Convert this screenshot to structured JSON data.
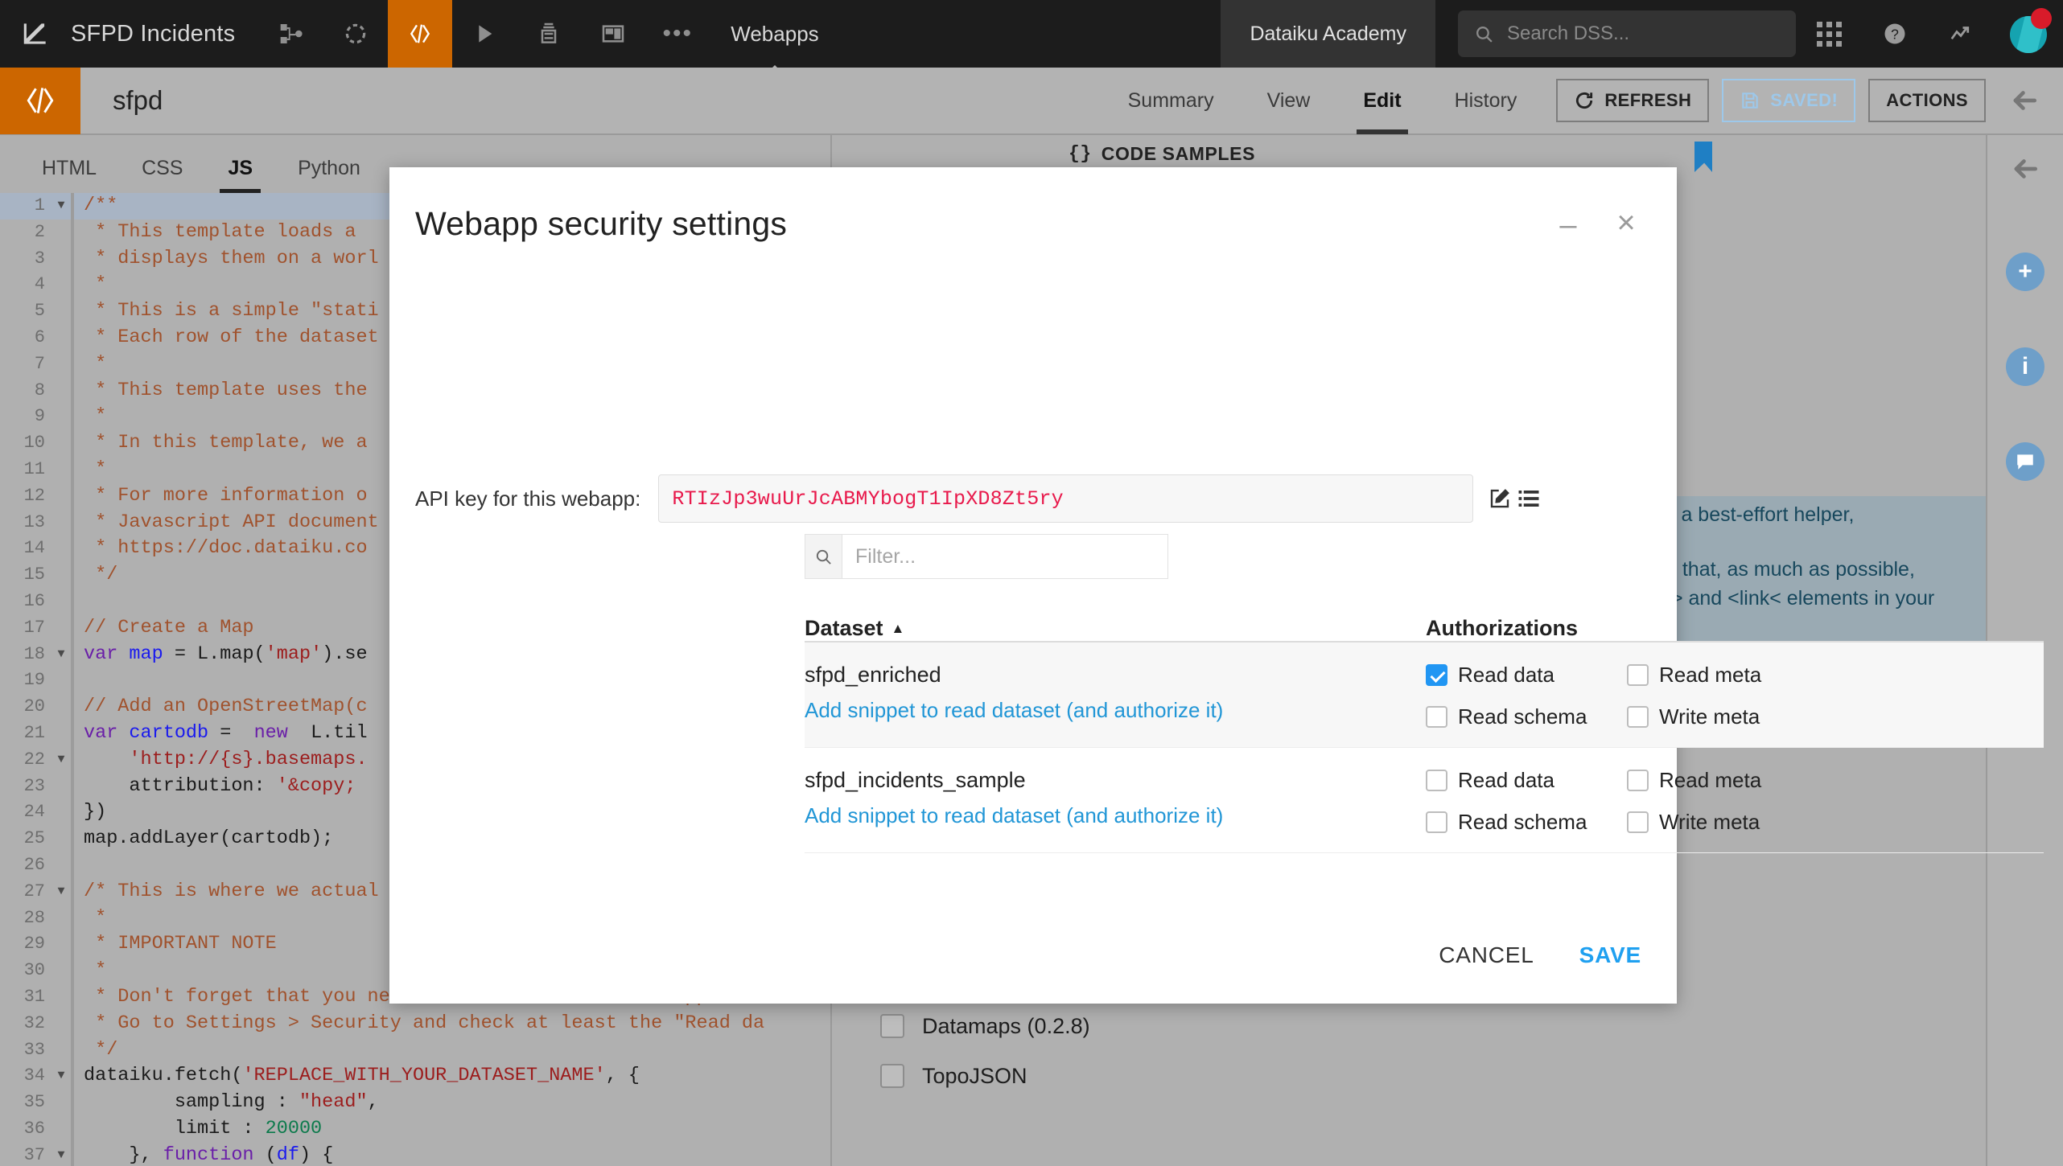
{
  "topnav": {
    "logo_icon": "dataiku-logo-icon",
    "project_name": "SFPD Incidents",
    "icons": [
      {
        "name": "flow-icon"
      },
      {
        "name": "lab-icon"
      },
      {
        "name": "code-icon"
      },
      {
        "name": "automation-icon"
      },
      {
        "name": "jobs-icon"
      },
      {
        "name": "dashboards-icon"
      },
      {
        "name": "more-icon"
      }
    ],
    "section_label": "Webapps",
    "academy_label": "Dataiku Academy",
    "search_placeholder": "Search DSS...",
    "right_icons": [
      {
        "name": "apps-grid-icon"
      },
      {
        "name": "help-icon"
      },
      {
        "name": "activity-icon"
      },
      {
        "name": "avatar"
      }
    ]
  },
  "subbar": {
    "webapp_icon": "code-webapp-icon",
    "title": "sfpd",
    "tabs": [
      {
        "label": "Summary",
        "active": false
      },
      {
        "label": "View",
        "active": false
      },
      {
        "label": "Edit",
        "active": true
      },
      {
        "label": "History",
        "active": false
      }
    ],
    "refresh_label": "REFRESH",
    "saved_label": "SAVED!",
    "actions_label": "ACTIONS",
    "collapse_icon": "arrow-left-icon"
  },
  "editor": {
    "tabs": [
      {
        "label": "HTML",
        "active": false
      },
      {
        "label": "CSS",
        "active": false
      },
      {
        "label": "JS",
        "active": true
      },
      {
        "label": "Python",
        "active": false
      }
    ],
    "lines": [
      {
        "n": 1,
        "fold": true,
        "hl": true,
        "parts": [
          {
            "t": "/**",
            "c": "c-com"
          }
        ]
      },
      {
        "n": 2,
        "fold": false,
        "hl": false,
        "parts": [
          {
            "t": " * This template loads a ",
            "c": "c-com"
          }
        ]
      },
      {
        "n": 3,
        "fold": false,
        "hl": false,
        "parts": [
          {
            "t": " * displays them on a worl",
            "c": "c-com"
          }
        ]
      },
      {
        "n": 4,
        "fold": false,
        "hl": false,
        "parts": [
          {
            "t": " *",
            "c": "c-com"
          }
        ]
      },
      {
        "n": 5,
        "fold": false,
        "hl": false,
        "parts": [
          {
            "t": " * This is a simple \"stati",
            "c": "c-com"
          }
        ]
      },
      {
        "n": 6,
        "fold": false,
        "hl": false,
        "parts": [
          {
            "t": " * Each row of the dataset",
            "c": "c-com"
          }
        ]
      },
      {
        "n": 7,
        "fold": false,
        "hl": false,
        "parts": [
          {
            "t": " *",
            "c": "c-com"
          }
        ]
      },
      {
        "n": 8,
        "fold": false,
        "hl": false,
        "parts": [
          {
            "t": " * This template uses the",
            "c": "c-com"
          }
        ]
      },
      {
        "n": 9,
        "fold": false,
        "hl": false,
        "parts": [
          {
            "t": " *",
            "c": "c-com"
          }
        ]
      },
      {
        "n": 10,
        "fold": false,
        "hl": false,
        "parts": [
          {
            "t": " * In this template, we a",
            "c": "c-com"
          }
        ]
      },
      {
        "n": 11,
        "fold": false,
        "hl": false,
        "parts": [
          {
            "t": " *",
            "c": "c-com"
          }
        ]
      },
      {
        "n": 12,
        "fold": false,
        "hl": false,
        "parts": [
          {
            "t": " * For more information o",
            "c": "c-com"
          }
        ]
      },
      {
        "n": 13,
        "fold": false,
        "hl": false,
        "parts": [
          {
            "t": " * Javascript API document",
            "c": "c-com"
          }
        ]
      },
      {
        "n": 14,
        "fold": false,
        "hl": false,
        "parts": [
          {
            "t": " * https://doc.dataiku.co",
            "c": "c-com"
          }
        ]
      },
      {
        "n": 15,
        "fold": false,
        "hl": false,
        "parts": [
          {
            "t": " */",
            "c": "c-com"
          }
        ]
      },
      {
        "n": 16,
        "fold": false,
        "hl": false,
        "parts": []
      },
      {
        "n": 17,
        "fold": false,
        "hl": false,
        "parts": [
          {
            "t": "// Create a Map",
            "c": "c-com"
          }
        ]
      },
      {
        "n": 18,
        "fold": true,
        "hl": false,
        "parts": [
          {
            "t": "var ",
            "c": "c-kw"
          },
          {
            "t": "map",
            "c": "c-var"
          },
          {
            "t": " = L.map(",
            "c": "ctext"
          },
          {
            "t": "'map'",
            "c": "c-str"
          },
          {
            "t": ").se",
            "c": "ctext"
          }
        ]
      },
      {
        "n": 19,
        "fold": false,
        "hl": false,
        "parts": []
      },
      {
        "n": 20,
        "fold": false,
        "hl": false,
        "parts": [
          {
            "t": "// Add an OpenStreetMap(c",
            "c": "c-com"
          }
        ]
      },
      {
        "n": 21,
        "fold": false,
        "hl": false,
        "parts": [
          {
            "t": "var ",
            "c": "c-kw"
          },
          {
            "t": "cartodb",
            "c": "c-var"
          },
          {
            "t": " =  ",
            "c": "ctext"
          },
          {
            "t": "new",
            "c": "c-kw"
          },
          {
            "t": "  L.til",
            "c": "ctext"
          }
        ]
      },
      {
        "n": 22,
        "fold": true,
        "hl": false,
        "parts": [
          {
            "t": "    ",
            "c": "ctext"
          },
          {
            "t": "'http://{s}.basemaps.",
            "c": "c-str"
          }
        ]
      },
      {
        "n": 23,
        "fold": false,
        "hl": false,
        "parts": [
          {
            "t": "    attribution: ",
            "c": "ctext"
          },
          {
            "t": "'&copy; ",
            "c": "c-str"
          }
        ]
      },
      {
        "n": 24,
        "fold": false,
        "hl": false,
        "parts": [
          {
            "t": "})",
            "c": "ctext"
          }
        ]
      },
      {
        "n": 25,
        "fold": false,
        "hl": false,
        "parts": [
          {
            "t": "map.addLayer(cartodb);",
            "c": "ctext"
          }
        ]
      },
      {
        "n": 26,
        "fold": false,
        "hl": false,
        "parts": []
      },
      {
        "n": 27,
        "fold": true,
        "hl": false,
        "parts": [
          {
            "t": "/* This is where we actual",
            "c": "c-com"
          }
        ]
      },
      {
        "n": 28,
        "fold": false,
        "hl": false,
        "parts": [
          {
            "t": " *",
            "c": "c-com"
          }
        ]
      },
      {
        "n": 29,
        "fold": false,
        "hl": false,
        "parts": [
          {
            "t": " * IMPORTANT NOTE",
            "c": "c-com"
          }
        ]
      },
      {
        "n": 30,
        "fold": false,
        "hl": false,
        "parts": [
          {
            "t": " *",
            "c": "c-com"
          }
        ]
      },
      {
        "n": 31,
        "fold": false,
        "hl": false,
        "parts": [
          {
            "t": " * Don't forget that you need to authorize this web app to r",
            "c": "c-com"
          }
        ]
      },
      {
        "n": 32,
        "fold": false,
        "hl": false,
        "parts": [
          {
            "t": " * Go to Settings > Security and check at least the \"Read da",
            "c": "c-com"
          }
        ]
      },
      {
        "n": 33,
        "fold": false,
        "hl": false,
        "parts": [
          {
            "t": " */",
            "c": "c-com"
          }
        ]
      },
      {
        "n": 34,
        "fold": true,
        "hl": false,
        "parts": [
          {
            "t": "dataiku.fetch(",
            "c": "ctext"
          },
          {
            "t": "'REPLACE_WITH_YOUR_DATASET_NAME'",
            "c": "c-str"
          },
          {
            "t": ", {",
            "c": "ctext"
          }
        ]
      },
      {
        "n": 35,
        "fold": false,
        "hl": false,
        "parts": [
          {
            "t": "        sampling : ",
            "c": "ctext"
          },
          {
            "t": "\"head\"",
            "c": "c-str"
          },
          {
            "t": ",",
            "c": "ctext"
          }
        ]
      },
      {
        "n": 36,
        "fold": false,
        "hl": false,
        "parts": [
          {
            "t": "        limit : ",
            "c": "ctext"
          },
          {
            "t": "20000",
            "c": "c-num"
          }
        ]
      },
      {
        "n": 37,
        "fold": true,
        "hl": false,
        "parts": [
          {
            "t": "    }, ",
            "c": "ctext"
          },
          {
            "t": "function",
            "c": "c-kw"
          },
          {
            "t": " (",
            "c": "ctext"
          },
          {
            "t": "df",
            "c": "c-var"
          },
          {
            "t": ") {",
            "c": "ctext"
          }
        ]
      }
    ]
  },
  "rightpanel": {
    "code_samples_label": "CODE SAMPLES",
    "code_samples_icon": "braces-icon",
    "info_lines": [
      "s a best-effort helper,",
      "d that, as much as possible,",
      "t> and <link< elements in your"
    ],
    "libraries": [
      {
        "label": "Datamaps (0.2.8)",
        "checked": false
      },
      {
        "label": "TopoJSON",
        "checked": false
      }
    ],
    "rail_icons": [
      {
        "name": "arrow-left-icon"
      },
      {
        "name": "plus-icon"
      },
      {
        "name": "info-icon"
      },
      {
        "name": "comment-icon"
      }
    ]
  },
  "modal": {
    "title": "Webapp security settings",
    "minimize_icon": "minimize-icon",
    "close_icon": "close-icon",
    "apikey_label": "API key for this webapp:",
    "apikey_value": "RTIzJp3wuUrJcABMYbogT1IpXD8Zt5ry",
    "apikey_edit_icon": "edit-icon",
    "apikey_list_icon": "list-icon",
    "filter_placeholder": "Filter...",
    "filter_value": "",
    "filter_icon": "search-icon",
    "columns": {
      "dataset": "Dataset",
      "dataset_sort": "▲",
      "authorizations": "Authorizations"
    },
    "rows": [
      {
        "name": "sfpd_enriched",
        "snippet_link": "Add snippet to read dataset (and authorize it)",
        "shaded": true,
        "perms": [
          {
            "label": "Read data",
            "checked": true
          },
          {
            "label": "Read meta",
            "checked": false
          },
          {
            "label": "Read schema",
            "checked": false
          },
          {
            "label": "Write meta",
            "checked": false
          }
        ]
      },
      {
        "name": "sfpd_incidents_sample",
        "snippet_link": "Add snippet to read dataset (and authorize it)",
        "shaded": false,
        "perms": [
          {
            "label": "Read data",
            "checked": false
          },
          {
            "label": "Read meta",
            "checked": false
          },
          {
            "label": "Read schema",
            "checked": false
          },
          {
            "label": "Write meta",
            "checked": false
          }
        ]
      }
    ],
    "cancel_label": "CANCEL",
    "save_label": "SAVE"
  },
  "colors": {
    "accent_orange": "#cc6600",
    "link_blue": "#2196d6",
    "save_blue": "#1fa0f0",
    "apikey_pink": "#e8194b",
    "checked_blue": "#2196f3"
  }
}
